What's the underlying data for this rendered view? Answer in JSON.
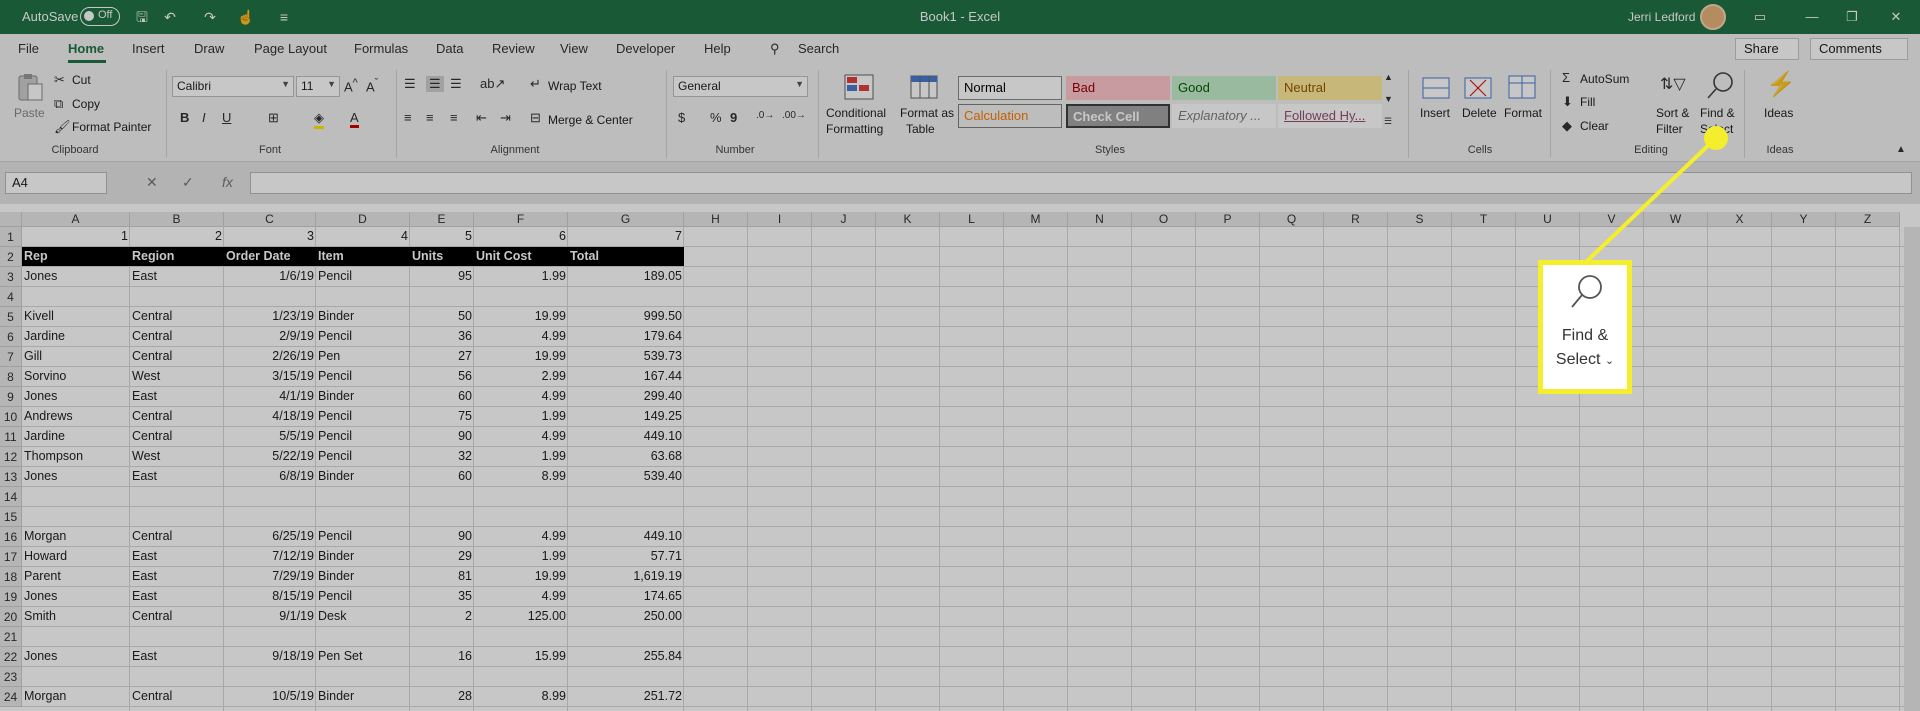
{
  "titlebar": {
    "autosave_label": "AutoSave",
    "autosave_state": "Off",
    "document": "Book1  -  Excel",
    "user": "Jerri Ledford"
  },
  "tabs": [
    "File",
    "Home",
    "Insert",
    "Draw",
    "Page Layout",
    "Formulas",
    "Data",
    "Review",
    "View",
    "Developer",
    "Help"
  ],
  "search_label": "Search",
  "share_label": "Share",
  "comments_label": "Comments",
  "ribbon": {
    "clipboard": {
      "paste": "Paste",
      "cut": "Cut",
      "copy": "Copy",
      "format_painter": "Format Painter",
      "label": "Clipboard"
    },
    "font": {
      "name": "Calibri",
      "size": "11",
      "label": "Font"
    },
    "alignment": {
      "wrap": "Wrap Text",
      "merge": "Merge & Center",
      "label": "Alignment"
    },
    "number": {
      "format": "General",
      "label": "Number"
    },
    "styles": {
      "cond_formatting": "Conditional",
      "cond_formatting_2": "Formatting",
      "format_table": "Format as",
      "format_table_2": "Table",
      "label": "Styles",
      "cells": [
        {
          "name": "Normal",
          "bg": "#ffffff",
          "fg": "#000000",
          "border": "#8a8a8a"
        },
        {
          "name": "Bad",
          "bg": "#ffc7ce",
          "fg": "#9c0006",
          "border": "#ffc7ce"
        },
        {
          "name": "Good",
          "bg": "#c6efce",
          "fg": "#006100",
          "border": "#c6efce"
        },
        {
          "name": "Neutral",
          "bg": "#ffeb9c",
          "fg": "#9c5700",
          "border": "#ffeb9c"
        },
        {
          "name": "Calculation",
          "bg": "#f2f2f2",
          "fg": "#fa7d00",
          "border": "#7f7f7f"
        },
        {
          "name": "Check Cell",
          "bg": "#a5a5a5",
          "fg": "#ffffff",
          "border": "#3f3f3f"
        },
        {
          "name": "Explanatory ...",
          "bg": "#ffffff",
          "fg": "#7f7f7f",
          "border": "#ffffff"
        },
        {
          "name": "Followed Hy...",
          "bg": "#ffffff",
          "fg": "#954f72",
          "border": "#ffffff"
        }
      ]
    },
    "cells": {
      "insert": "Insert",
      "delete": "Delete",
      "format": "Format",
      "label": "Cells"
    },
    "editing": {
      "autosum": "AutoSum",
      "fill": "Fill",
      "clear": "Clear",
      "sort": "Sort &",
      "sort_2": "Filter",
      "find": "Find &",
      "find_2": "Select",
      "label": "Editing"
    },
    "ideas": {
      "ideas": "Ideas",
      "label": "Ideas"
    }
  },
  "formula_bar": {
    "name_box": "A4",
    "fx": "fx",
    "value": ""
  },
  "columns": [
    "A",
    "B",
    "C",
    "D",
    "E",
    "F",
    "G",
    "H",
    "I",
    "J",
    "K",
    "L",
    "M",
    "N",
    "O",
    "P",
    "Q",
    "R",
    "S",
    "T",
    "U",
    "V",
    "W",
    "X",
    "Y",
    "Z"
  ],
  "rows": [
    {
      "n": "1",
      "cells": [
        "",
        "1",
        "2",
        "3",
        "4",
        "5",
        "6",
        "7"
      ]
    },
    {
      "n": "2",
      "cells": [
        "header",
        "Rep",
        "Region",
        "Order Date",
        "Item",
        "Units",
        "Unit Cost",
        "Total"
      ]
    },
    {
      "n": "3",
      "cells": [
        "",
        "Jones",
        "East",
        "1/6/19",
        "Pencil",
        "95",
        "1.99",
        "189.05"
      ]
    },
    {
      "n": "4",
      "cells": [
        "",
        "",
        "",
        "",
        "",
        "",
        "",
        ""
      ]
    },
    {
      "n": "5",
      "cells": [
        "",
        "Kivell",
        "Central",
        "1/23/19",
        "Binder",
        "50",
        "19.99",
        "999.50"
      ]
    },
    {
      "n": "6",
      "cells": [
        "",
        "Jardine",
        "Central",
        "2/9/19",
        "Pencil",
        "36",
        "4.99",
        "179.64"
      ]
    },
    {
      "n": "7",
      "cells": [
        "",
        "Gill",
        "Central",
        "2/26/19",
        "Pen",
        "27",
        "19.99",
        "539.73"
      ]
    },
    {
      "n": "8",
      "cells": [
        "",
        "Sorvino",
        "West",
        "3/15/19",
        "Pencil",
        "56",
        "2.99",
        "167.44"
      ]
    },
    {
      "n": "9",
      "cells": [
        "",
        "Jones",
        "East",
        "4/1/19",
        "Binder",
        "60",
        "4.99",
        "299.40"
      ]
    },
    {
      "n": "10",
      "cells": [
        "",
        "Andrews",
        "Central",
        "4/18/19",
        "Pencil",
        "75",
        "1.99",
        "149.25"
      ]
    },
    {
      "n": "11",
      "cells": [
        "",
        "Jardine",
        "Central",
        "5/5/19",
        "Pencil",
        "90",
        "4.99",
        "449.10"
      ]
    },
    {
      "n": "12",
      "cells": [
        "",
        "Thompson",
        "West",
        "5/22/19",
        "Pencil",
        "32",
        "1.99",
        "63.68"
      ]
    },
    {
      "n": "13",
      "cells": [
        "",
        "Jones",
        "East",
        "6/8/19",
        "Binder",
        "60",
        "8.99",
        "539.40"
      ]
    },
    {
      "n": "14",
      "cells": [
        "",
        "",
        "",
        "",
        "",
        "",
        "",
        ""
      ]
    },
    {
      "n": "15",
      "cells": [
        "",
        "",
        "",
        "",
        "",
        "",
        "",
        ""
      ]
    },
    {
      "n": "16",
      "cells": [
        "",
        "Morgan",
        "Central",
        "6/25/19",
        "Pencil",
        "90",
        "4.99",
        "449.10"
      ]
    },
    {
      "n": "17",
      "cells": [
        "",
        "Howard",
        "East",
        "7/12/19",
        "Binder",
        "29",
        "1.99",
        "57.71"
      ]
    },
    {
      "n": "18",
      "cells": [
        "",
        "Parent",
        "East",
        "7/29/19",
        "Binder",
        "81",
        "19.99",
        "1,619.19"
      ]
    },
    {
      "n": "19",
      "cells": [
        "",
        "Jones",
        "East",
        "8/15/19",
        "Pencil",
        "35",
        "4.99",
        "174.65"
      ]
    },
    {
      "n": "20",
      "cells": [
        "",
        "Smith",
        "Central",
        "9/1/19",
        "Desk",
        "2",
        "125.00",
        "250.00"
      ]
    },
    {
      "n": "21",
      "cells": [
        "",
        "",
        "",
        "",
        "",
        "",
        "",
        ""
      ]
    },
    {
      "n": "22",
      "cells": [
        "",
        "Jones",
        "East",
        "9/18/19",
        "Pen Set",
        "16",
        "15.99",
        "255.84"
      ]
    },
    {
      "n": "23",
      "cells": [
        "",
        "",
        "",
        "",
        "",
        "",
        "",
        ""
      ]
    },
    {
      "n": "24",
      "cells": [
        "",
        "Morgan",
        "Central",
        "10/5/19",
        "Binder",
        "28",
        "8.99",
        "251.72"
      ]
    }
  ],
  "callout": {
    "line1": "Find &",
    "line2": "Select",
    "accent": "#f5ee2c"
  },
  "colors": {
    "brand": "#217346"
  }
}
